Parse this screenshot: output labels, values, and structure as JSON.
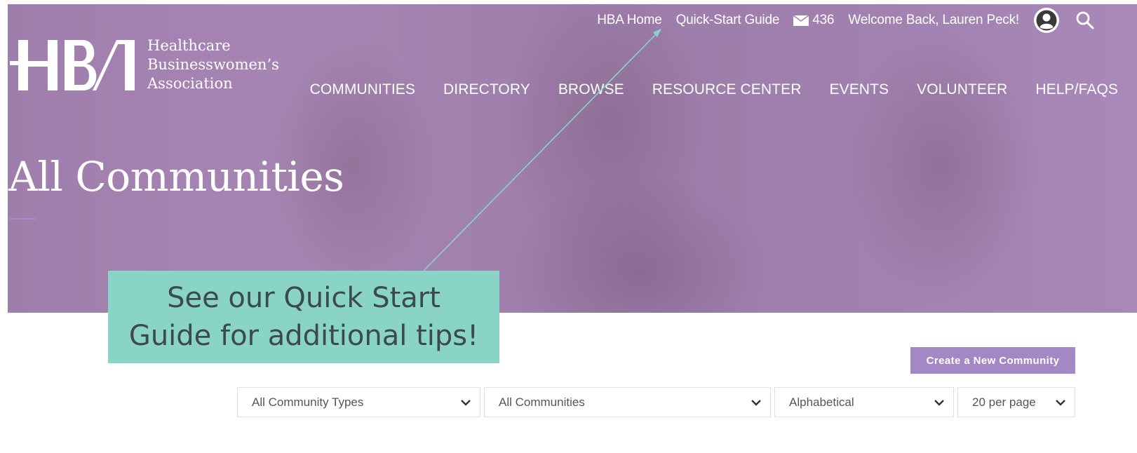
{
  "header": {
    "logo_lines": [
      "Healthcare",
      "Businesswomen’s",
      "Association"
    ],
    "utility": {
      "home_link": "HBA Home",
      "guide_link": "Quick-Start Guide",
      "mail_count": "436",
      "welcome": "Welcome Back, Lauren Peck!"
    },
    "nav": [
      "COMMUNITIES",
      "DIRECTORY",
      "BROWSE",
      "RESOURCE CENTER",
      "EVENTS",
      "VOLUNTEER",
      "HELP/FAQS"
    ]
  },
  "hero": {
    "title": "All Communities"
  },
  "callout": {
    "lines": [
      "See our Quick Start",
      "Guide for additional tips!"
    ]
  },
  "toolbar": {
    "create_label": "Create a New Community"
  },
  "filters": {
    "type_selected": "All Community Types",
    "community_selected": "All Communities",
    "sort_selected": "Alphabetical",
    "per_page_selected": "20 per page"
  },
  "colors": {
    "accent_purple": "#a487c5",
    "callout_teal": "#89d4c6",
    "hero_purple": "#a585b0"
  },
  "icons": {
    "mail": "envelope-icon",
    "profile": "user-circle-icon",
    "search": "search-icon",
    "dropdown": "chevron-down-icon"
  }
}
